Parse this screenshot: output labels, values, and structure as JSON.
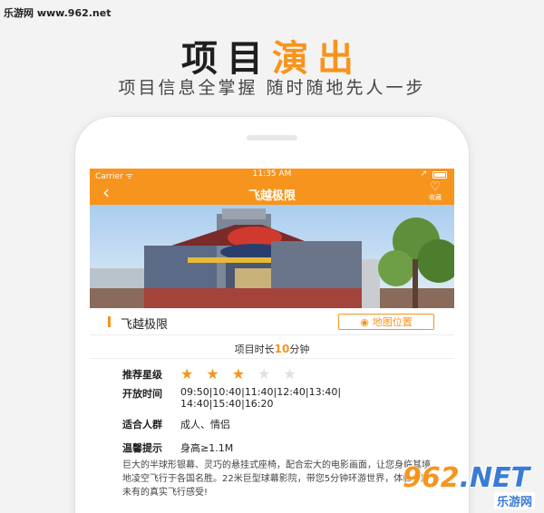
{
  "watermark_top": "乐游网 www.962.net",
  "hero": {
    "title_part1": "项目",
    "title_part2": "演出",
    "subtitle": "项目信息全掌握   随时随地先人一步"
  },
  "status_bar": {
    "carrier": "Carrier ᯤ",
    "time": "11:35 AM",
    "location_icon": "↗"
  },
  "nav": {
    "back_icon": "‹",
    "title": "飞越极限",
    "fav_icon": "♡",
    "fav_label": "收藏"
  },
  "attraction": {
    "name": "飞越极限",
    "map_button_icon": "◉",
    "map_button": "地图位置"
  },
  "duration": {
    "prefix": "项目时长",
    "value": "10",
    "suffix": "分钟"
  },
  "details": {
    "rating_label": "推荐星级",
    "rating": 3,
    "rating_max": 5,
    "hours_label": "开放时间",
    "hours_line1": "09:50|10:40|11:40|12:40|13:40|",
    "hours_line2": "14:40|15:40|16:20",
    "audience_label": "适合人群",
    "audience": "成人、情侣",
    "tips_label": "温馨提示",
    "tips": "身高≥1.1M",
    "description": "巨大的半球形银幕、灵巧的悬挂式座椅，配合宏大的电影画面，让您身临其境地凌空飞行于各国名胜。22米巨型球幕影院，带您5分钟环游世界，体验前所未有的真实飞行感受!"
  },
  "watermark_logo": {
    "main": "962",
    "tld": ".NET",
    "sub": "乐游网"
  },
  "colors": {
    "accent": "#f7941d",
    "background": "#f3f3f3"
  }
}
